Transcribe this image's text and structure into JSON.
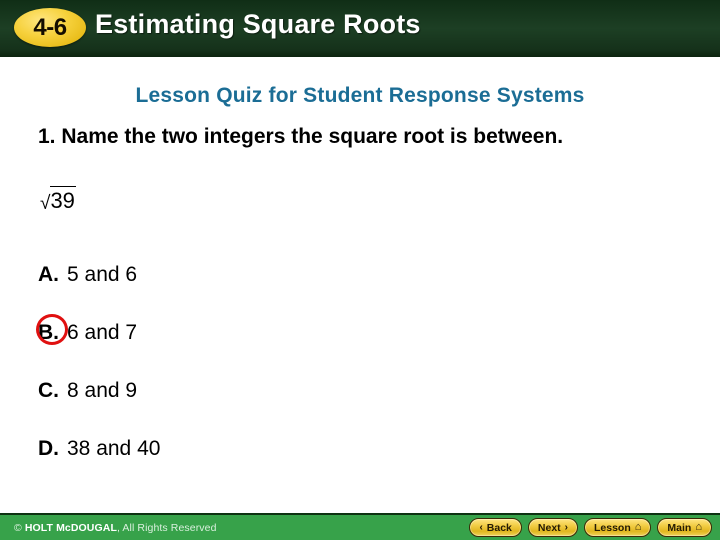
{
  "header": {
    "badge_label": "4-6",
    "title": "Estimating Square Roots",
    "badge_color": "#f2cd3c",
    "bar_color": "#16331b"
  },
  "lesson": {
    "subtitle": "Lesson Quiz for Student Response Systems",
    "subtitle_color": "#1b6d95"
  },
  "question": {
    "number": "1.",
    "prompt": "1. Name the two integers the square root is between.",
    "expression_symbol": "√",
    "expression_radicand": "39",
    "expression_plain": "√39"
  },
  "choices": [
    {
      "letter": "A.",
      "text": "5 and 6",
      "selected": false
    },
    {
      "letter": "B.",
      "text": "6 and 7",
      "selected": true
    },
    {
      "letter": "C.",
      "text": "8 and 9",
      "selected": false
    },
    {
      "letter": "D.",
      "text": "38 and 40",
      "selected": false
    }
  ],
  "selection": {
    "highlight_color": "#e01010",
    "highlighted_letter": "B."
  },
  "footer": {
    "copyright_symbol": "© ",
    "copyright_brand": "HOLT McDOUGAL",
    "copyright_rest": ", All Rights Reserved",
    "bar_color": "#37a24a",
    "buttons": [
      {
        "label": "Back",
        "glyph": "‹",
        "glyph_position": "before",
        "icon": "chevron-left-icon"
      },
      {
        "label": "Next",
        "glyph": "›",
        "glyph_position": "after",
        "icon": "chevron-right-icon"
      },
      {
        "label": "Lesson",
        "glyph": "⌂",
        "glyph_position": "after",
        "icon": "home-icon"
      },
      {
        "label": "Main",
        "glyph": "⌂",
        "glyph_position": "after",
        "icon": "home-icon"
      }
    ]
  }
}
